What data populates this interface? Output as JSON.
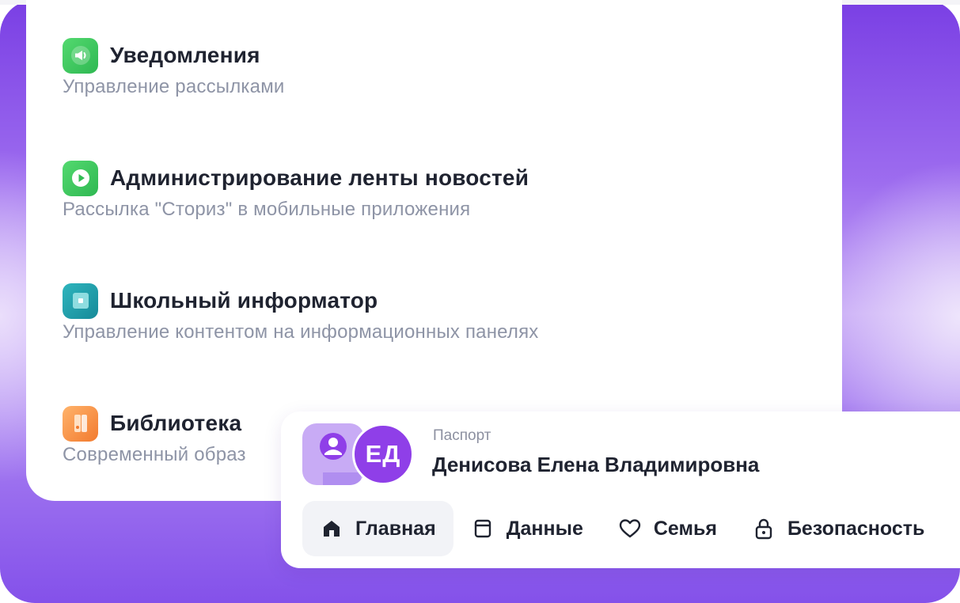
{
  "services": [
    {
      "id": "notifications",
      "icon": "megaphone-icon",
      "color": "#3fc65f",
      "title": "Уведомления",
      "description": "Управление рассылками"
    },
    {
      "id": "news-feed",
      "icon": "play-icon",
      "color": "#3fc65f",
      "title": "Администрирование ленты новостей",
      "description": "Рассылка \"Сториз\" в мобильные приложения"
    },
    {
      "id": "school-informer",
      "icon": "panel-icon",
      "color": "#1f9eab",
      "title": "Школьный информатор",
      "description": "Управление контентом на информационных панелях"
    },
    {
      "id": "library",
      "icon": "book-icon",
      "color": "#f7883a",
      "title": "Библиотека",
      "description": "Современный образ"
    }
  ],
  "profile": {
    "document_label": "Паспорт",
    "avatar_initials": "ЕД",
    "full_name": "Денисова Елена Владимировна",
    "tabs": [
      {
        "label": "Главная",
        "icon": "home-icon",
        "active": true
      },
      {
        "label": "Данные",
        "icon": "folder-icon",
        "active": false
      },
      {
        "label": "Семья",
        "icon": "heart-icon",
        "active": false
      },
      {
        "label": "Безопасность",
        "icon": "lock-icon",
        "active": false
      }
    ]
  },
  "colors": {
    "accent": "#8f3fe8",
    "background_purple": "#7a3fe4",
    "text_primary": "#1f2330",
    "text_secondary": "#8e94a6"
  }
}
